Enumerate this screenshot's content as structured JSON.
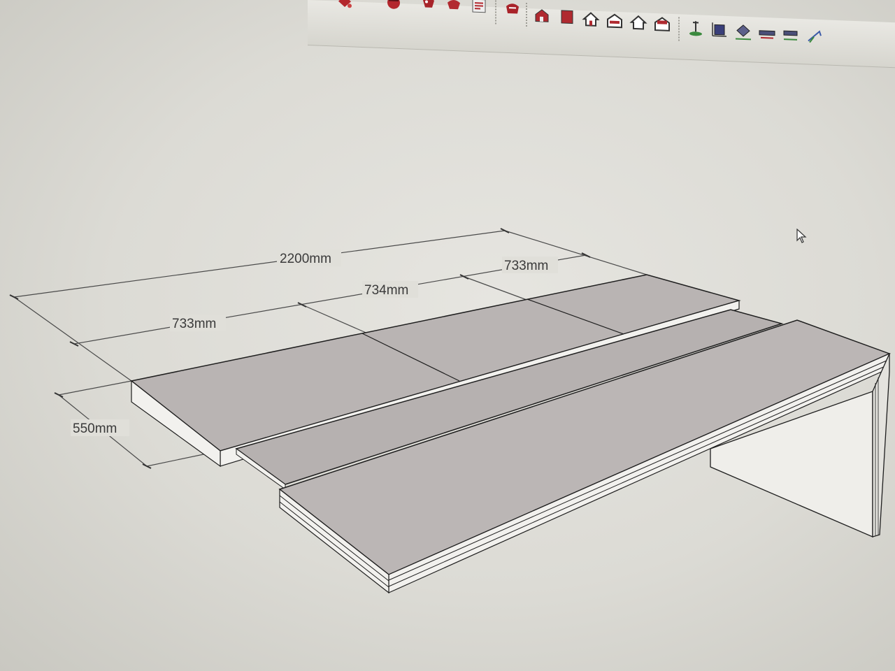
{
  "toolbar": {
    "groups": [
      {
        "name": "camera-tools",
        "icons": [
          "paint-bucket-icon",
          "paint-bucket-icon",
          "model-info-icon",
          "component-icon"
        ]
      },
      {
        "name": "view-tools",
        "icons": [
          "iso-view-icon",
          "front-view-icon",
          "top-view-icon",
          "right-view-icon",
          "back-view-icon",
          "left-view-icon"
        ]
      },
      {
        "name": "sandbox-tools",
        "icons": [
          "sandbox-contours-icon",
          "sandbox-from-scratch-icon",
          "smoove-icon",
          "stamp-icon",
          "drape-icon",
          "flip-edge-icon"
        ]
      }
    ]
  },
  "model": {
    "dimensions": [
      {
        "id": "overall-length",
        "label": "2200mm"
      },
      {
        "id": "segment-1-length",
        "label": "733mm"
      },
      {
        "id": "segment-2-length",
        "label": "734mm"
      },
      {
        "id": "segment-3-length",
        "label": "733mm"
      },
      {
        "id": "depth",
        "label": "550mm"
      }
    ]
  },
  "colors": {
    "panel_top": "#b9b4b3",
    "panel_top_shade": "#aaa4a3",
    "panel_edge": "#f2f1ee",
    "edge_line": "#1e1e1e",
    "dim_line": "#4a4a4a",
    "leg_face": "#efeeea"
  }
}
